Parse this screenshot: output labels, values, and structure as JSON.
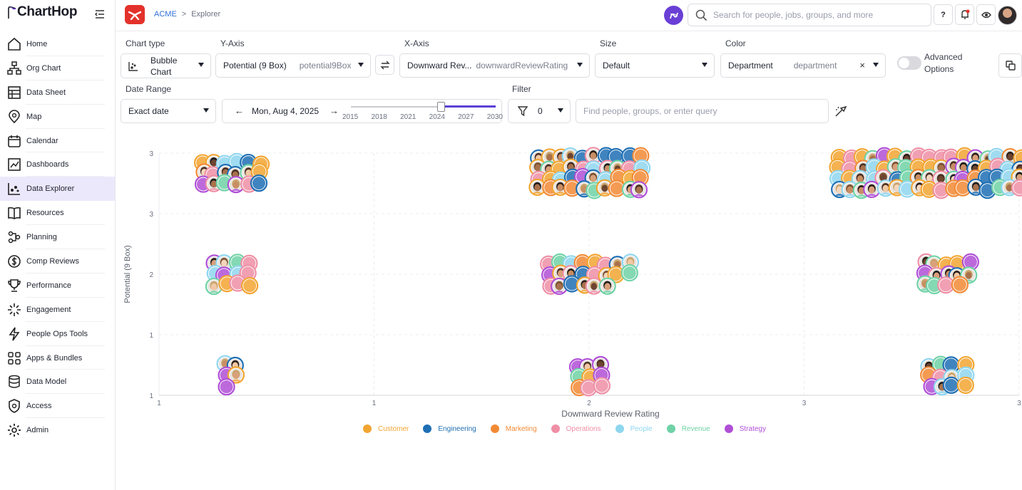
{
  "app": {
    "name": "ChartHop"
  },
  "sidebar": {
    "items": [
      {
        "label": "Home",
        "icon": "home-icon"
      },
      {
        "label": "Org Chart",
        "icon": "org-chart-icon"
      },
      {
        "label": "Data Sheet",
        "icon": "data-sheet-icon"
      },
      {
        "label": "Map",
        "icon": "map-pin-icon"
      },
      {
        "label": "Calendar",
        "icon": "calendar-icon"
      },
      {
        "label": "Dashboards",
        "icon": "dashboard-icon"
      },
      {
        "label": "Data Explorer",
        "icon": "data-explorer-icon",
        "active": true
      },
      {
        "label": "Resources",
        "icon": "book-icon"
      },
      {
        "label": "Planning",
        "icon": "planning-icon"
      },
      {
        "label": "Comp Reviews",
        "icon": "dollar-icon"
      },
      {
        "label": "Performance",
        "icon": "trophy-icon"
      },
      {
        "label": "Engagement",
        "icon": "sparkle-icon"
      },
      {
        "label": "People Ops Tools",
        "icon": "bolt-icon"
      },
      {
        "label": "Apps & Bundles",
        "icon": "apps-grid-icon"
      },
      {
        "label": "Data Model",
        "icon": "database-icon"
      },
      {
        "label": "Access",
        "icon": "shield-icon"
      },
      {
        "label": "Admin",
        "icon": "gear-icon"
      }
    ]
  },
  "topbar": {
    "breadcrumb": {
      "org": "ACME",
      "separator": ">",
      "page": "Explorer"
    },
    "search_placeholder": "Search for people, jobs, groups, and more",
    "help_label": "?"
  },
  "controls": {
    "chart_type": {
      "label": "Chart type",
      "value": "Bubble Chart"
    },
    "y_axis": {
      "label": "Y-Axis",
      "value": "Potential (9 Box)",
      "field": "potential9Box"
    },
    "x_axis": {
      "label": "X-Axis",
      "value": "Downward Rev...",
      "field": "downwardReviewRating"
    },
    "size": {
      "label": "Size",
      "value": "Default"
    },
    "color": {
      "label": "Color",
      "value": "Department",
      "field": "department",
      "clear": "×"
    },
    "advanced_options": "Advanced Options",
    "date_range": {
      "label": "Date Range",
      "mode": "Exact date",
      "date": "Mon, Aug 4, 2025",
      "ticks": [
        "2015",
        "2018",
        "2021",
        "2024",
        "2027",
        "2030"
      ],
      "selected_fraction": 0.62
    },
    "filter": {
      "label": "Filter",
      "count": "0",
      "query_placeholder": "Find people, groups, or enter query"
    }
  },
  "chart_data": {
    "type": "scatter",
    "subtype": "bubble",
    "xlabel": "Downward Review Rating",
    "ylabel": "Potential (9 Box)",
    "x_tick_labels": [
      "1",
      "1",
      "2",
      "3",
      "3"
    ],
    "y_tick_labels": [
      "3",
      "3",
      "2",
      "1",
      "1"
    ],
    "grid": true,
    "legend_position": "bottom",
    "series": [
      {
        "name": "Customer",
        "color": "#f2a531"
      },
      {
        "name": "Engineering",
        "color": "#1f6fb4"
      },
      {
        "name": "Marketing",
        "color": "#f28a35"
      },
      {
        "name": "Operations",
        "color": "#ef8fa6"
      },
      {
        "name": "People",
        "color": "#8fd6ef"
      },
      {
        "name": "Revenue",
        "color": "#6fd2a6"
      },
      {
        "name": "Strategy",
        "color": "#b04fd6"
      }
    ],
    "clusters": [
      {
        "x_col": 0,
        "y_row": 0,
        "count": 18
      },
      {
        "x_col": 1,
        "y_row": 0,
        "count": 40
      },
      {
        "x_col": 2,
        "y_row": 0,
        "count": 80
      },
      {
        "x_col": 0,
        "y_row": 1,
        "count": 12
      },
      {
        "x_col": 1,
        "y_row": 1,
        "count": 22
      },
      {
        "x_col": 2,
        "y_row": 1,
        "count": 14
      },
      {
        "x_col": 0,
        "y_row": 2,
        "count": 5
      },
      {
        "x_col": 1,
        "y_row": 2,
        "count": 9
      },
      {
        "x_col": 2,
        "y_row": 2,
        "count": 12
      }
    ]
  }
}
